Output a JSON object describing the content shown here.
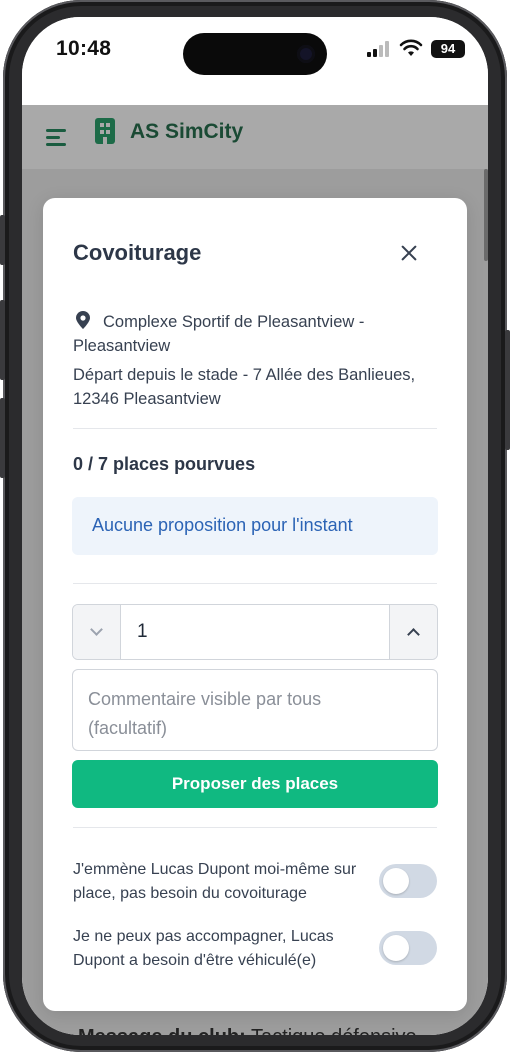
{
  "status_bar": {
    "time": "10:48",
    "battery": "94"
  },
  "app": {
    "brand": "AS SimCity"
  },
  "background": {
    "peek_text_bold": "Message du club:",
    "peek_text": "Tactique défensive"
  },
  "modal": {
    "title": "Covoiturage",
    "location": "Complexe Sportif de Pleasantview - Pleasantview",
    "departure": "Départ depuis le stade - 7 Allée des Banlieues, 12346 Pleasantview",
    "seats_filled": "0 / 7 places pourvues",
    "empty_notice": "Aucune proposition pour l'instant",
    "seat_count": "1",
    "comment_placeholder": "Commentaire visible par tous (facultatif)",
    "submit_label": "Proposer des places",
    "options": [
      {
        "label": "J'emmène Lucas Dupont moi-même sur place, pas besoin du covoiturage",
        "enabled": false
      },
      {
        "label": "Je ne peux pas accompagner, Lucas Dupont a besoin d'être véhiculé(e)",
        "enabled": false
      }
    ]
  },
  "colors": {
    "primary_button": "#10b981",
    "info_text": "#2b63b5",
    "brand": "#1d6b48"
  },
  "icons": [
    "menu-icon",
    "building-icon",
    "location-pin-icon",
    "close-icon",
    "chevron-down-icon",
    "chevron-up-icon"
  ]
}
